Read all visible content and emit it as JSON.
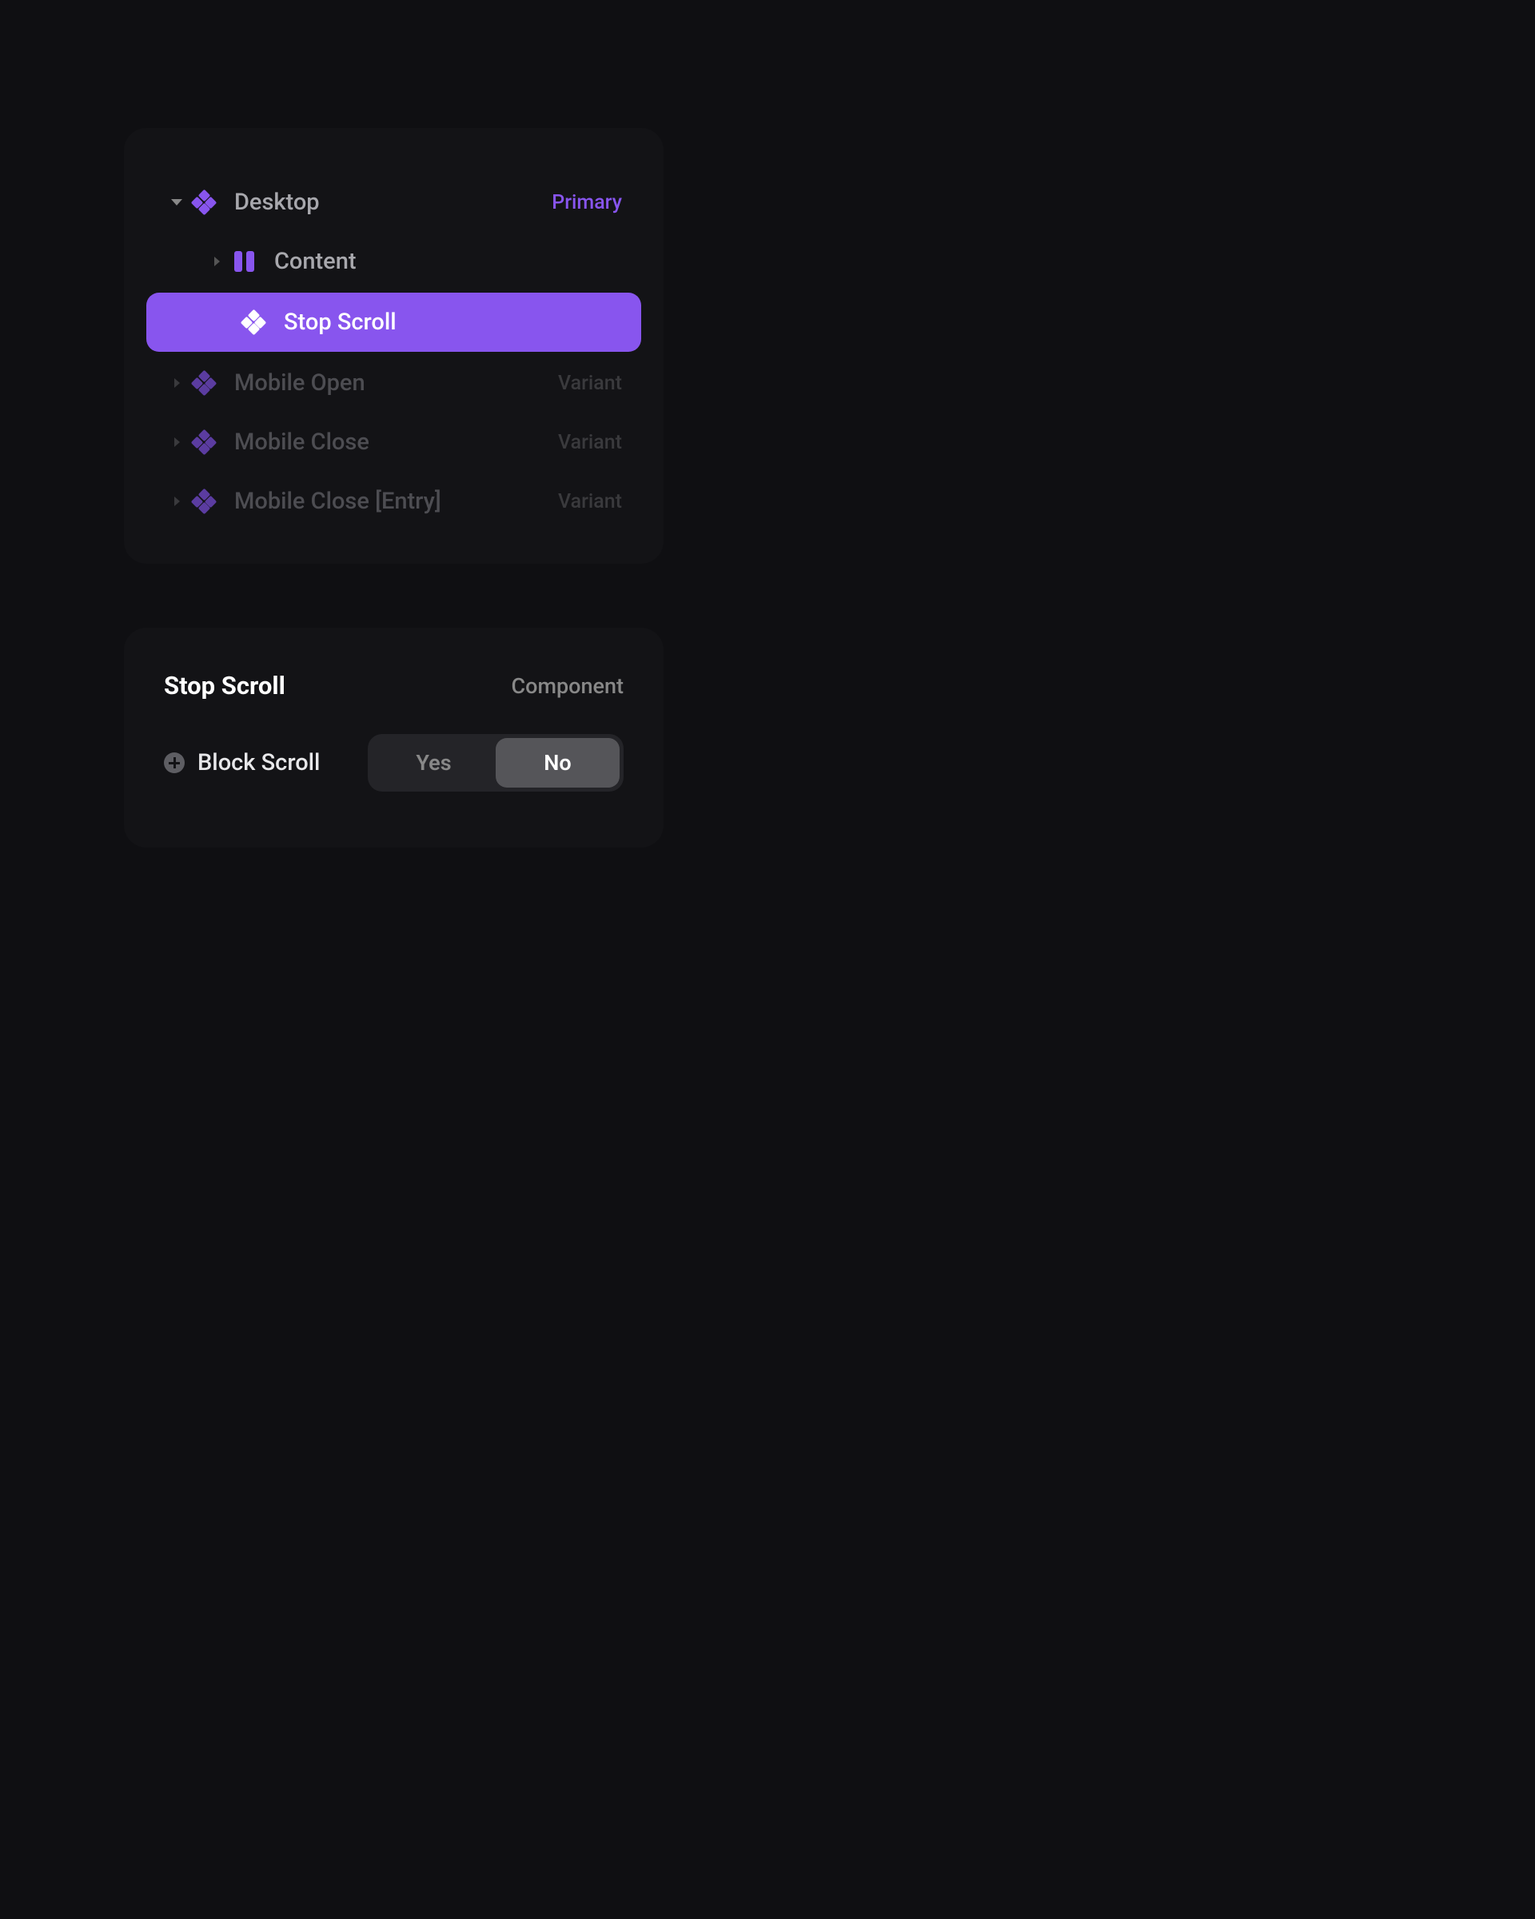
{
  "tree": {
    "rows": [
      {
        "label": "Desktop",
        "badge": "Primary"
      },
      {
        "label": "Content"
      },
      {
        "label": "Stop Scroll"
      },
      {
        "label": "Mobile Open",
        "badge": "Variant"
      },
      {
        "label": "Mobile Close",
        "badge": "Variant"
      },
      {
        "label": "Mobile Close [Entry]",
        "badge": "Variant"
      }
    ]
  },
  "props": {
    "title": "Stop Scroll",
    "type": "Component",
    "blockScroll": {
      "label": "Block Scroll",
      "options": {
        "yes": "Yes",
        "no": "No"
      }
    }
  }
}
